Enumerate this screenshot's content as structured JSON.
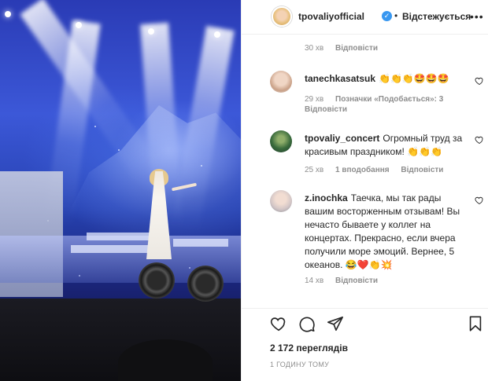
{
  "header": {
    "username": "tpovaliyofficial",
    "separator": "•",
    "follow_label": "Відстежується",
    "more_icon": "more-options-icon"
  },
  "top_meta": {
    "time": "30 хв",
    "reply_label": "Відповісти"
  },
  "comments": [
    {
      "username": "tanechkasatsuk",
      "text": "👏👏👏🤩🤩🤩",
      "time": "29 хв",
      "likes_label": "Позначки «Подобається»: 3",
      "reply_label": "Відповісти"
    },
    {
      "username": "tpovaliy_concert",
      "text": "Огромный труд за красивым праздником! 👏👏👏",
      "time": "25 хв",
      "likes_label": "1 вподобання",
      "reply_label": "Відповісти"
    },
    {
      "username": "z.inochka",
      "text": "Таечка, мы так рады вашим восторженным отзывам! Вы нечасто бываете у коллег на концертах. Прекрасно, если вчера получили море эмоций. Вернее, 5 океанов. 😂❤️👏💥",
      "time": "14 хв",
      "reply_label": "Відповісти"
    }
  ],
  "footer": {
    "views": "2 172 переглядів",
    "posted": "1 ГОДИНУ ТОМУ"
  },
  "colors": {
    "verified": "#3897f0",
    "muted": "#8e8e8e",
    "text": "#262626"
  }
}
